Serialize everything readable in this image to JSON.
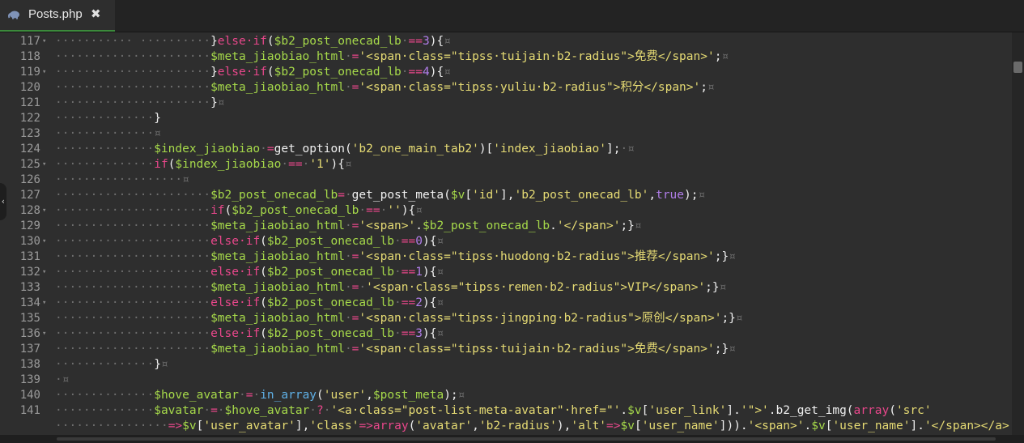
{
  "tab": {
    "filename": "Posts.php",
    "close_glyph": "✖",
    "icon": "elephant-icon"
  },
  "side_handle": {
    "glyph": "‹"
  },
  "colors": {
    "background": "#2e2e2e",
    "variable": "#a6d94a",
    "keyword": "#e8478b",
    "string": "#e6db74",
    "function": "#5fb0e6",
    "constant": "#b07de8",
    "whitespace_marker": "#6f6f6f",
    "tab_accent": "#3c8a3c"
  },
  "lines": [
    {
      "num": "117",
      "fold": true,
      "tokens": [
        [
          "ws",
          "··········· ··········"
        ],
        [
          "p",
          "}"
        ],
        [
          "k",
          "else·if"
        ],
        [
          "p",
          "("
        ],
        [
          "v",
          "$b2_post_onecad_lb"
        ],
        [
          "ws",
          "·"
        ],
        [
          "k",
          "=="
        ],
        [
          "n",
          "3"
        ],
        [
          "p",
          "){"
        ],
        [
          "c",
          "¤"
        ]
      ]
    },
    {
      "num": "118",
      "fold": false,
      "tokens": [
        [
          "ws",
          "······················"
        ],
        [
          "v",
          "$meta_jiaobiao_html"
        ],
        [
          "ws",
          "·"
        ],
        [
          "k",
          "="
        ],
        [
          "s",
          "'<span·class=\"tipss·tuijain·b2-radius\">免费</span>'"
        ],
        [
          "p",
          ";"
        ],
        [
          "c",
          "¤"
        ]
      ]
    },
    {
      "num": "119",
      "fold": true,
      "tokens": [
        [
          "ws",
          "······················"
        ],
        [
          "p",
          "}"
        ],
        [
          "k",
          "else·if"
        ],
        [
          "p",
          "("
        ],
        [
          "v",
          "$b2_post_onecad_lb"
        ],
        [
          "ws",
          "·"
        ],
        [
          "k",
          "=="
        ],
        [
          "n",
          "4"
        ],
        [
          "p",
          "){"
        ],
        [
          "c",
          "¤"
        ]
      ]
    },
    {
      "num": "120",
      "fold": false,
      "tokens": [
        [
          "ws",
          "······················"
        ],
        [
          "v",
          "$meta_jiaobiao_html"
        ],
        [
          "ws",
          "·"
        ],
        [
          "k",
          "="
        ],
        [
          "s",
          "'<span·class=\"tipss·yuliu·b2-radius\">积分</span>'"
        ],
        [
          "p",
          ";"
        ],
        [
          "c",
          "¤"
        ]
      ]
    },
    {
      "num": "121",
      "fold": false,
      "tokens": [
        [
          "ws",
          "······················"
        ],
        [
          "p",
          "}"
        ],
        [
          "c",
          "¤"
        ]
      ]
    },
    {
      "num": "122",
      "fold": false,
      "tokens": [
        [
          "ws",
          "··············"
        ],
        [
          "p",
          "}"
        ]
      ]
    },
    {
      "num": "123",
      "fold": false,
      "tokens": [
        [
          "ws",
          "··············"
        ],
        [
          "c",
          "¤"
        ]
      ]
    },
    {
      "num": "124",
      "fold": false,
      "tokens": [
        [
          "ws",
          "··············"
        ],
        [
          "v",
          "$index_jiaobiao"
        ],
        [
          "ws",
          "·"
        ],
        [
          "k",
          "="
        ],
        [
          "p",
          "get_option("
        ],
        [
          "s",
          "'b2_one_main_tab2'"
        ],
        [
          "p",
          ")["
        ],
        [
          "s",
          "'index_jiaobiao'"
        ],
        [
          "p",
          "];"
        ],
        [
          "ws",
          "·"
        ],
        [
          "c",
          "¤"
        ]
      ]
    },
    {
      "num": "125",
      "fold": true,
      "tokens": [
        [
          "ws",
          "··············"
        ],
        [
          "k",
          "if"
        ],
        [
          "p",
          "("
        ],
        [
          "v",
          "$index_jiaobiao"
        ],
        [
          "ws",
          "·"
        ],
        [
          "k",
          "=="
        ],
        [
          "ws",
          "·"
        ],
        [
          "s",
          "'1'"
        ],
        [
          "p",
          "){"
        ],
        [
          "c",
          "¤"
        ]
      ]
    },
    {
      "num": "126",
      "fold": false,
      "tokens": [
        [
          "ws",
          "··················"
        ],
        [
          "c",
          "¤"
        ]
      ]
    },
    {
      "num": "127",
      "fold": false,
      "tokens": [
        [
          "ws",
          "······················"
        ],
        [
          "v",
          "$b2_post_onecad_lb"
        ],
        [
          "k",
          "="
        ],
        [
          "ws",
          "·"
        ],
        [
          "p",
          "get_post_meta("
        ],
        [
          "v",
          "$v"
        ],
        [
          "p",
          "["
        ],
        [
          "s",
          "'id'"
        ],
        [
          "p",
          "],"
        ],
        [
          "s",
          "'b2_post_onecad_lb'"
        ],
        [
          "p",
          ","
        ],
        [
          "n",
          "true"
        ],
        [
          "p",
          ");"
        ],
        [
          "c",
          "¤"
        ]
      ]
    },
    {
      "num": "128",
      "fold": true,
      "tokens": [
        [
          "ws",
          "······················"
        ],
        [
          "k",
          "if"
        ],
        [
          "p",
          "("
        ],
        [
          "v",
          "$b2_post_onecad_lb"
        ],
        [
          "ws",
          "·"
        ],
        [
          "k",
          "=="
        ],
        [
          "ws",
          "·"
        ],
        [
          "s",
          "''"
        ],
        [
          "p",
          "){"
        ],
        [
          "c",
          "¤"
        ]
      ]
    },
    {
      "num": "129",
      "fold": false,
      "tokens": [
        [
          "ws",
          "······················"
        ],
        [
          "v",
          "$meta_jiaobiao_html"
        ],
        [
          "ws",
          "·"
        ],
        [
          "k",
          "="
        ],
        [
          "s",
          "'<span>'"
        ],
        [
          "p",
          "."
        ],
        [
          "v",
          "$b2_post_onecad_lb"
        ],
        [
          "p",
          "."
        ],
        [
          "s",
          "'</span>'"
        ],
        [
          "p",
          ";}"
        ],
        [
          "c",
          "¤"
        ]
      ]
    },
    {
      "num": "130",
      "fold": true,
      "tokens": [
        [
          "ws",
          "······················"
        ],
        [
          "k",
          "else·if"
        ],
        [
          "p",
          "("
        ],
        [
          "v",
          "$b2_post_onecad_lb"
        ],
        [
          "ws",
          "·"
        ],
        [
          "k",
          "=="
        ],
        [
          "n",
          "0"
        ],
        [
          "p",
          "){"
        ],
        [
          "c",
          "¤"
        ]
      ]
    },
    {
      "num": "131",
      "fold": false,
      "tokens": [
        [
          "ws",
          "······················"
        ],
        [
          "v",
          "$meta_jiaobiao_html"
        ],
        [
          "ws",
          "·"
        ],
        [
          "k",
          "="
        ],
        [
          "s",
          "'<span·class=\"tipss·huodong·b2-radius\">推荐</span>'"
        ],
        [
          "p",
          ";}"
        ],
        [
          "c",
          "¤"
        ]
      ]
    },
    {
      "num": "132",
      "fold": true,
      "tokens": [
        [
          "ws",
          "······················"
        ],
        [
          "k",
          "else·if"
        ],
        [
          "p",
          "("
        ],
        [
          "v",
          "$b2_post_onecad_lb"
        ],
        [
          "ws",
          "·"
        ],
        [
          "k",
          "=="
        ],
        [
          "n",
          "1"
        ],
        [
          "p",
          "){"
        ],
        [
          "c",
          "¤"
        ]
      ]
    },
    {
      "num": "133",
      "fold": false,
      "tokens": [
        [
          "ws",
          "······················"
        ],
        [
          "v",
          "$meta_jiaobiao_html"
        ],
        [
          "ws",
          "·"
        ],
        [
          "k",
          "="
        ],
        [
          "ws",
          "·"
        ],
        [
          "s",
          "'<span·class=\"tipss·remen·b2-radius\">VIP</span>'"
        ],
        [
          "p",
          ";}"
        ],
        [
          "c",
          "¤"
        ]
      ]
    },
    {
      "num": "134",
      "fold": true,
      "tokens": [
        [
          "ws",
          "······················"
        ],
        [
          "k",
          "else·if"
        ],
        [
          "p",
          "("
        ],
        [
          "v",
          "$b2_post_onecad_lb"
        ],
        [
          "ws",
          "·"
        ],
        [
          "k",
          "=="
        ],
        [
          "n",
          "2"
        ],
        [
          "p",
          "){"
        ],
        [
          "c",
          "¤"
        ]
      ]
    },
    {
      "num": "135",
      "fold": false,
      "tokens": [
        [
          "ws",
          "······················"
        ],
        [
          "v",
          "$meta_jiaobiao_html"
        ],
        [
          "ws",
          "·"
        ],
        [
          "k",
          "="
        ],
        [
          "s",
          "'<span·class=\"tipss·jingping·b2-radius\">原创</span>'"
        ],
        [
          "p",
          ";}"
        ],
        [
          "c",
          "¤"
        ]
      ]
    },
    {
      "num": "136",
      "fold": true,
      "tokens": [
        [
          "ws",
          "······················"
        ],
        [
          "k",
          "else·if"
        ],
        [
          "p",
          "("
        ],
        [
          "v",
          "$b2_post_onecad_lb"
        ],
        [
          "ws",
          "·"
        ],
        [
          "k",
          "=="
        ],
        [
          "n",
          "3"
        ],
        [
          "p",
          "){"
        ],
        [
          "c",
          "¤"
        ]
      ]
    },
    {
      "num": "137",
      "fold": false,
      "tokens": [
        [
          "ws",
          "······················"
        ],
        [
          "v",
          "$meta_jiaobiao_html"
        ],
        [
          "ws",
          "·"
        ],
        [
          "k",
          "="
        ],
        [
          "s",
          "'<span·class=\"tipss·tuijain·b2-radius\">免费</span>'"
        ],
        [
          "p",
          ";}"
        ],
        [
          "c",
          "¤"
        ]
      ]
    },
    {
      "num": "138",
      "fold": false,
      "tokens": [
        [
          "ws",
          "··············"
        ],
        [
          "p",
          "}"
        ],
        [
          "c",
          "¤"
        ]
      ]
    },
    {
      "num": "139",
      "fold": false,
      "tokens": [
        [
          "ws",
          "·"
        ],
        [
          "c",
          "¤"
        ]
      ]
    },
    {
      "num": "140",
      "fold": false,
      "tokens": [
        [
          "ws",
          "··············"
        ],
        [
          "v",
          "$hove_avatar"
        ],
        [
          "ws",
          "·"
        ],
        [
          "k",
          "="
        ],
        [
          "ws",
          "·"
        ],
        [
          "f",
          "in_array"
        ],
        [
          "p",
          "("
        ],
        [
          "s",
          "'user'"
        ],
        [
          "p",
          ","
        ],
        [
          "v",
          "$post_meta"
        ],
        [
          "p",
          ");"
        ],
        [
          "c",
          "¤"
        ]
      ]
    },
    {
      "num": "141",
      "fold": false,
      "tokens": [
        [
          "ws",
          "··············"
        ],
        [
          "v",
          "$avatar"
        ],
        [
          "ws",
          "·"
        ],
        [
          "k",
          "="
        ],
        [
          "ws",
          "·"
        ],
        [
          "v",
          "$hove_avatar"
        ],
        [
          "ws",
          "·"
        ],
        [
          "k",
          "?"
        ],
        [
          "ws",
          "·"
        ],
        [
          "s",
          "'<a·class=\"post-list-meta-avatar\"·href=\"'"
        ],
        [
          "p",
          "."
        ],
        [
          "v",
          "$v"
        ],
        [
          "p",
          "["
        ],
        [
          "s",
          "'user_link'"
        ],
        [
          "p",
          "]."
        ],
        [
          "s",
          "'\">'"
        ],
        [
          "p",
          ".b2_get_img("
        ],
        [
          "k",
          "array"
        ],
        [
          "p",
          "("
        ],
        [
          "s",
          "'src'"
        ]
      ]
    },
    {
      "num": "",
      "fold": false,
      "tokens": [
        [
          "ws",
          "················"
        ],
        [
          "k",
          "=>"
        ],
        [
          "v",
          "$v"
        ],
        [
          "p",
          "["
        ],
        [
          "s",
          "'user_avatar'"
        ],
        [
          "p",
          "],"
        ],
        [
          "s",
          "'class'"
        ],
        [
          "k",
          "=>"
        ],
        [
          "k",
          "array"
        ],
        [
          "p",
          "("
        ],
        [
          "s",
          "'avatar'"
        ],
        [
          "p",
          ","
        ],
        [
          "s",
          "'b2-radius'"
        ],
        [
          "p",
          "),"
        ],
        [
          "s",
          "'alt'"
        ],
        [
          "k",
          "=>"
        ],
        [
          "v",
          "$v"
        ],
        [
          "p",
          "["
        ],
        [
          "s",
          "'user_name'"
        ],
        [
          "p",
          "]))."
        ],
        [
          "s",
          "'<span>'"
        ],
        [
          "p",
          "."
        ],
        [
          "v",
          "$v"
        ],
        [
          "p",
          "["
        ],
        [
          "s",
          "'user_name'"
        ],
        [
          "p",
          "]."
        ],
        [
          "s",
          "'</span></a>'"
        ],
        [
          "ws",
          "·"
        ],
        [
          "k",
          ":"
        ]
      ]
    }
  ]
}
